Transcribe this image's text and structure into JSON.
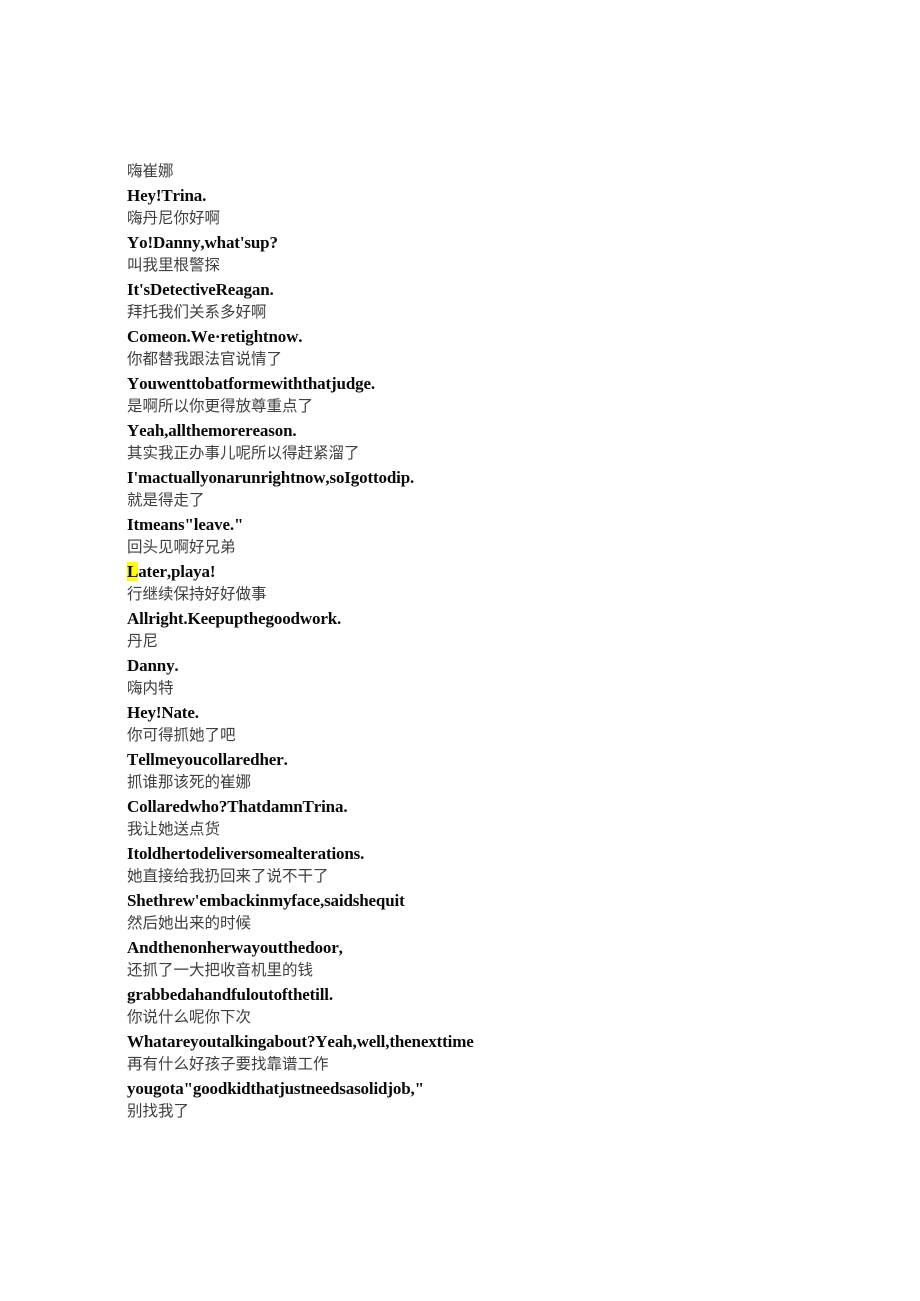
{
  "document": {
    "background_color": "#ffffff",
    "text_color_source": "#3f3f3f",
    "text_color_translation": "#0a0a0a",
    "highlight_color": "#ffff00",
    "lines": [
      {
        "id": "l1",
        "lang": "cn",
        "text": "嗨崔娜"
      },
      {
        "id": "l2",
        "lang": "en",
        "text": "Hey!Trina."
      },
      {
        "id": "l3",
        "lang": "cn",
        "text": "嗨丹尼你好啊"
      },
      {
        "id": "l4",
        "lang": "en",
        "text": "Yo!Danny,what'sup?"
      },
      {
        "id": "l5",
        "lang": "cn",
        "text": "叫我里根警探"
      },
      {
        "id": "l6",
        "lang": "en",
        "text": "It'sDetectiveReagan."
      },
      {
        "id": "l7",
        "lang": "cn",
        "text": "拜托我们关系多好啊"
      },
      {
        "id": "l8",
        "lang": "en",
        "text": "Comeon.We·retightnow."
      },
      {
        "id": "l9",
        "lang": "cn",
        "text": "你都替我跟法官说情了"
      },
      {
        "id": "l10",
        "lang": "en",
        "text": "Youwenttobatformewiththatjudge."
      },
      {
        "id": "l11",
        "lang": "cn",
        "text": "是啊所以你更得放尊重点了"
      },
      {
        "id": "l12",
        "lang": "en",
        "text": "Yeah,allthemorereason."
      },
      {
        "id": "l13",
        "lang": "cn",
        "text": "其实我正办事儿呢所以得赶紧溜了"
      },
      {
        "id": "l14",
        "lang": "en",
        "text": "I'mactuallyonarunrightnow,soIgottodip."
      },
      {
        "id": "l15",
        "lang": "cn",
        "text": "就是得走了"
      },
      {
        "id": "l16",
        "lang": "en",
        "text": "Itmeans\"leave.\""
      },
      {
        "id": "l17",
        "lang": "cn",
        "text": "回头见啊好兄弟"
      },
      {
        "id": "l18",
        "lang": "en",
        "text": "Later,playa!",
        "highlight": "L",
        "highlight_rest": "ater,playa!"
      },
      {
        "id": "l19",
        "lang": "cn",
        "text": "行继续保持好好做事"
      },
      {
        "id": "l20",
        "lang": "en",
        "text": "Allright.Keepupthegoodwork."
      },
      {
        "id": "l21",
        "lang": "cn",
        "text": "丹尼"
      },
      {
        "id": "l22",
        "lang": "en",
        "text": "Danny."
      },
      {
        "id": "l23",
        "lang": "cn",
        "text": "嗨内特"
      },
      {
        "id": "l24",
        "lang": "en",
        "text": "Hey!Nate."
      },
      {
        "id": "l25",
        "lang": "cn",
        "text": "你可得抓她了吧"
      },
      {
        "id": "l26",
        "lang": "en",
        "text": "Tellmeyoucollaredher."
      },
      {
        "id": "l27",
        "lang": "cn",
        "text": "抓谁那该死的崔娜"
      },
      {
        "id": "l28",
        "lang": "en",
        "text": "Collaredwho?ThatdamnTrina."
      },
      {
        "id": "l29",
        "lang": "cn",
        "text": "我让她送点货"
      },
      {
        "id": "l30",
        "lang": "en",
        "text": "Itoldhertodeliversomealterations."
      },
      {
        "id": "l31",
        "lang": "cn",
        "text": "她直接给我扔回来了说不干了"
      },
      {
        "id": "l32",
        "lang": "en",
        "text": "Shethrew'embackinmyface,saidshequit"
      },
      {
        "id": "l33",
        "lang": "cn",
        "text": "然后她出来的时候"
      },
      {
        "id": "l34",
        "lang": "en",
        "text": "Andthenonherwayoutthedoor,"
      },
      {
        "id": "l35",
        "lang": "cn",
        "text": "还抓了一大把收音机里的钱"
      },
      {
        "id": "l36",
        "lang": "en",
        "text": "grabbedahandfuloutofthetill."
      },
      {
        "id": "l37",
        "lang": "cn",
        "text": "你说什么呢你下次"
      },
      {
        "id": "l38",
        "lang": "en",
        "text": "Whatareyoutalkingabout?Yeah,well,thenexttime"
      },
      {
        "id": "l39",
        "lang": "cn",
        "text": "再有什么好孩子要找靠谱工作"
      },
      {
        "id": "l40",
        "lang": "en",
        "text": "yougota\"goodkidthatjustneedsasolidjob,\""
      },
      {
        "id": "l41",
        "lang": "cn",
        "text": "别找我了"
      }
    ]
  }
}
